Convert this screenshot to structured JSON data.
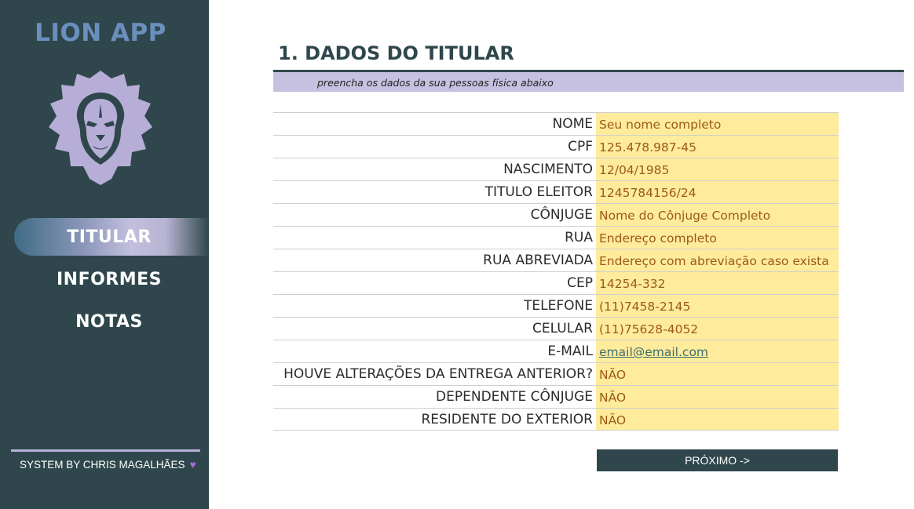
{
  "sidebar": {
    "app_title": "LION APP",
    "logo_icon": "lion-head-icon",
    "nav": [
      {
        "label": "TITULAR",
        "active": true
      },
      {
        "label": "INFORMES",
        "active": false
      },
      {
        "label": "NOTAS",
        "active": false
      }
    ],
    "footer": "SYSTEM BY CHRIS MAGALHÃES",
    "footer_icon": "purple-heart-icon"
  },
  "main": {
    "title": "1. DADOS DO TITULAR",
    "subtitle": "preencha os dados da sua pessoas física abaixo",
    "fields": [
      {
        "label": "NOME",
        "value": "Seu nome completo"
      },
      {
        "label": "CPF",
        "value": "125.478.987-45"
      },
      {
        "label": "NASCIMENTO",
        "value": "12/04/1985"
      },
      {
        "label": "TITULO ELEITOR",
        "value": "1245784156/24"
      },
      {
        "label": "CÔNJUGE",
        "value": "Nome do Cônjuge Completo"
      },
      {
        "label": "RUA",
        "value": "Endereço completo"
      },
      {
        "label": "RUA ABREVIADA",
        "value": "Endereço com abreviação caso exista"
      },
      {
        "label": "CEP",
        "value": "14254-332"
      },
      {
        "label": "TELEFONE",
        "value": "(11)7458-2145"
      },
      {
        "label": "CELULAR",
        "value": "(11)75628-4052"
      },
      {
        "label": "E-MAIL",
        "value": "email@email.com"
      },
      {
        "label": "HOUVE ALTERAÇÕES DA ENTREGA ANTERIOR?",
        "value": "NÃO"
      },
      {
        "label": "DEPENDENTE CÔNJUGE",
        "value": "NÃO"
      },
      {
        "label": "RESIDENTE DO EXTERIOR",
        "value": "NÃO"
      }
    ],
    "next_label": "PRÓXIMO ->"
  },
  "colors": {
    "sidebar_bg": "#2f474c",
    "accent_lavender": "#b7b1d8",
    "field_fill": "#ffeb9c",
    "field_text": "#9c5a14"
  }
}
